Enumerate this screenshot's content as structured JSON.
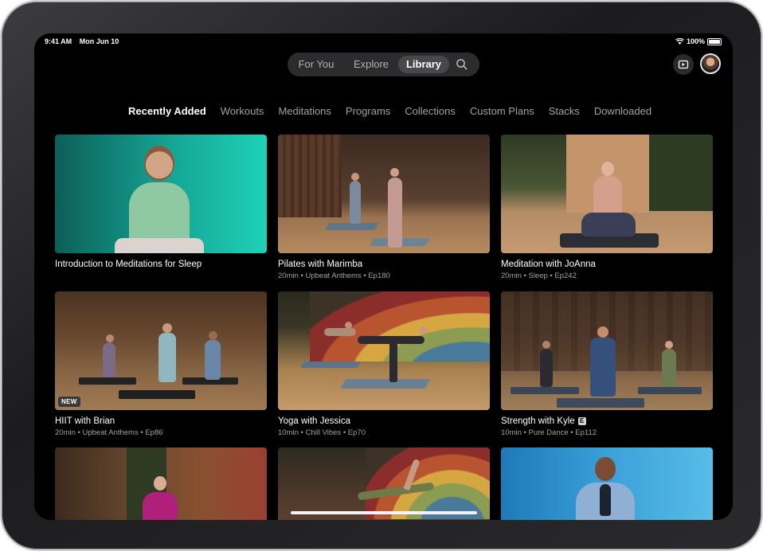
{
  "status_bar": {
    "time": "9:41 AM",
    "date": "Mon Jun 10",
    "battery": "100%"
  },
  "top_tabs": [
    {
      "label": "For You",
      "active": false
    },
    {
      "label": "Explore",
      "active": false
    },
    {
      "label": "Library",
      "active": true
    }
  ],
  "icons": {
    "search": "search-icon",
    "tv": "tv-icon",
    "avatar": "avatar"
  },
  "categories": [
    {
      "label": "Recently Added",
      "active": true
    },
    {
      "label": "Workouts",
      "active": false
    },
    {
      "label": "Meditations",
      "active": false
    },
    {
      "label": "Programs",
      "active": false
    },
    {
      "label": "Collections",
      "active": false
    },
    {
      "label": "Custom Plans",
      "active": false
    },
    {
      "label": "Stacks",
      "active": false
    },
    {
      "label": "Downloaded",
      "active": false
    }
  ],
  "cards": [
    {
      "title": "Introduction to Meditations for Sleep",
      "meta": ""
    },
    {
      "title": "Pilates with Marimba",
      "meta": "20min • Upbeat Anthems • Ep180"
    },
    {
      "title": "Meditation with JoAnna",
      "meta": "20min • Sleep • Ep242"
    },
    {
      "title": "HIIT with Brian",
      "meta": "20min • Upbeat Anthems • Ep86",
      "badge": "NEW"
    },
    {
      "title": "Yoga with Jessica",
      "meta": "10min • Chill Vibes • Ep70"
    },
    {
      "title": "Strength with Kyle",
      "meta": "10min • Pure Dance • Ep112",
      "explicit": "E"
    },
    {
      "title": "",
      "meta": ""
    },
    {
      "title": "",
      "meta": ""
    },
    {
      "title": "",
      "meta": ""
    }
  ],
  "colors": {
    "accent_teal": "#1fc9b0",
    "background": "#000000",
    "secondary_text": "#a1a1a6"
  }
}
